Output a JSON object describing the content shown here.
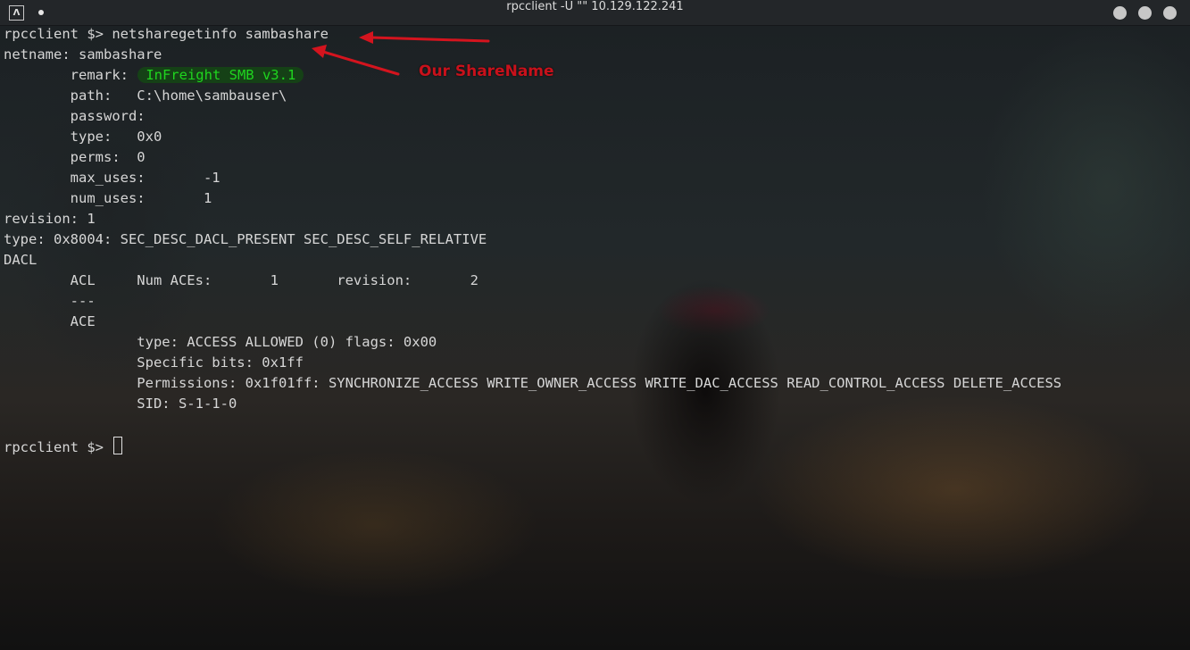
{
  "window": {
    "title": "rpcclient -U \"\" 10.129.122.241",
    "app_icon_glyph": "Λ"
  },
  "terminal": {
    "prompt": "rpcclient $> ",
    "command": "netsharegetinfo sambashare",
    "output": {
      "netname": "netname: sambashare",
      "remark_label": "        remark: ",
      "remark_value": "InFreight SMB v3.1",
      "path": "        path:   C:\\home\\sambauser\\",
      "password": "        password:",
      "type": "        type:   0x0",
      "perms": "        perms:  0",
      "max_uses": "        max_uses:       -1",
      "num_uses": "        num_uses:       1",
      "revision": "revision: 1",
      "sd_type": "type: 0x8004: SEC_DESC_DACL_PRESENT SEC_DESC_SELF_RELATIVE",
      "dacl": "DACL",
      "acl": "        ACL     Num ACEs:       1       revision:       2",
      "separator": "        ---",
      "ace": "        ACE",
      "ace_type": "                type: ACCESS ALLOWED (0) flags: 0x00",
      "specific_bits": "                Specific bits: 0x1ff",
      "permissions": "                Permissions: 0x1f01ff: SYNCHRONIZE_ACCESS WRITE_OWNER_ACCESS WRITE_DAC_ACCESS READ_CONTROL_ACCESS DELETE_ACCESS",
      "sid": "                SID: S-1-1-0"
    },
    "final_prompt": "rpcclient $> "
  },
  "annotation": {
    "text": "Our ShareName",
    "color": "#c8111b"
  },
  "colors": {
    "titlebar": "#232629",
    "text": "#d6d6d6",
    "highlight_text": "#1fd51f",
    "arrow": "#d4141e"
  }
}
